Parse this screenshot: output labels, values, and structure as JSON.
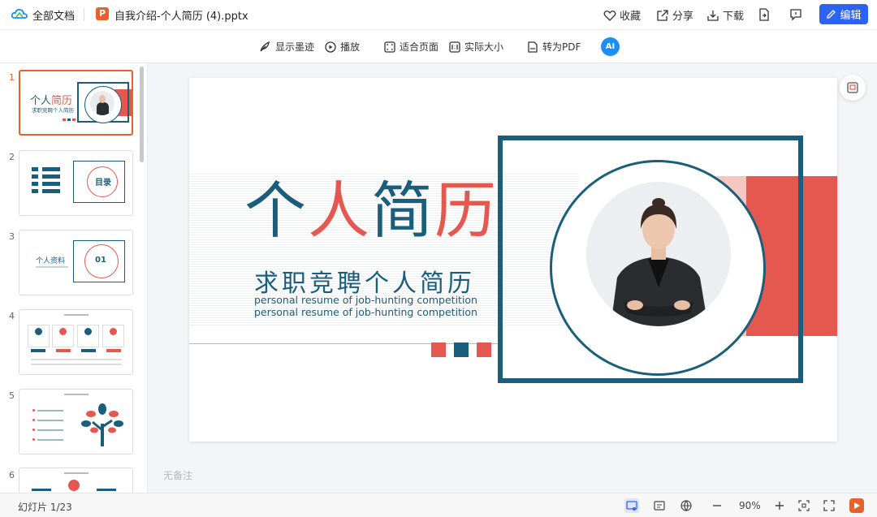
{
  "header": {
    "all_docs_label": "全部文档",
    "file_icon_letter": "P",
    "filename": "自我介绍-个人简历 (4).pptx",
    "actions": {
      "favorite": "收藏",
      "share": "分享",
      "download": "下载"
    },
    "edit_label": "编辑"
  },
  "toolbar": {
    "show_ink": "显示墨迹",
    "play": "播放",
    "fit_page": "适合页面",
    "actual_size": "实际大小",
    "to_pdf": "转为PDF",
    "ai_label": "AI"
  },
  "sidebar": {
    "slides": [
      {
        "number": "1",
        "active": true
      },
      {
        "number": "2",
        "active": false
      },
      {
        "number": "3",
        "active": false
      },
      {
        "number": "4",
        "active": false
      },
      {
        "number": "5",
        "active": false
      },
      {
        "number": "6",
        "active": false
      }
    ],
    "thumb_texts": {
      "t1_title_a": "个人",
      "t1_title_b": "简历",
      "t1_sub": "求职竞聘个人简历",
      "t2_label": "目录",
      "t3_label": "个人资料",
      "t3_num": "01"
    }
  },
  "slide": {
    "title_part1": "个",
    "title_part2": "人",
    "title_part3": "简",
    "title_part4": "历",
    "subtitle": "求职竞聘个人简历",
    "english": "personal resume of job-hunting competition personal resume of job-hunting competition"
  },
  "notes_placeholder": "无备注",
  "status": {
    "slide_counter": "幻灯片 1/23",
    "zoom": "90%"
  },
  "colors": {
    "teal": "#1b5e7b",
    "red": "#e5584f",
    "pink": "#f5c6c2",
    "accent_orange": "#e8602c",
    "edit_blue": "#2a63f5"
  }
}
